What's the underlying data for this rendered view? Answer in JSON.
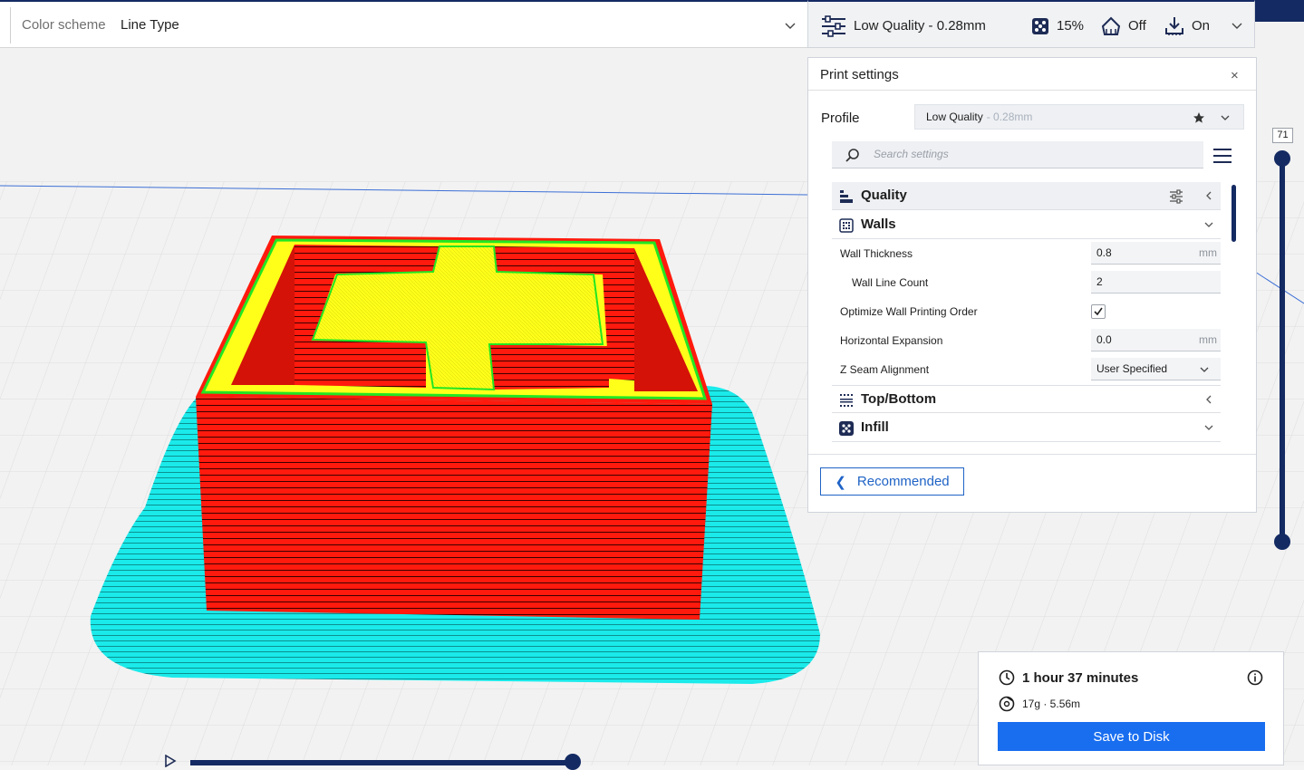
{
  "topbar": {
    "color_scheme_label": "Color scheme",
    "color_scheme_value": "Line Type",
    "quality_label": "Low Quality - 0.28mm",
    "infill_value": "15%",
    "support_value": "Off",
    "adhesion_value": "On"
  },
  "print_settings": {
    "title": "Print settings",
    "close_glyph": "×",
    "profile_label": "Profile",
    "profile_name": "Low Quality",
    "profile_detail": "- 0.28mm",
    "search_placeholder": "Search settings",
    "categories": {
      "quality": "Quality",
      "walls": "Walls",
      "top_bottom": "Top/Bottom",
      "infill": "Infill"
    },
    "settings": {
      "wall_thickness": {
        "label": "Wall Thickness",
        "value": "0.8",
        "unit": "mm"
      },
      "wall_line_count": {
        "label": "Wall Line Count",
        "value": "2"
      },
      "optimize_wall_order": {
        "label": "Optimize Wall Printing Order",
        "checked": true
      },
      "horizontal_expansion": {
        "label": "Horizontal Expansion",
        "value": "0.0",
        "unit": "mm"
      },
      "z_seam_alignment": {
        "label": "Z Seam Alignment",
        "value": "User Specified"
      }
    },
    "recommended_label": "Recommended"
  },
  "layer_slider": {
    "current_layer": "71"
  },
  "estimate": {
    "time": "1 hour 37 minutes",
    "material": "17g · 5.56m",
    "save_label": "Save to Disk"
  },
  "colors": {
    "accent_navy": "#142a63",
    "button_blue": "#196ef0",
    "wall_red": "#ff1a0d",
    "skin_yellow": "#ffff1a",
    "inner_wall_green": "#22e622",
    "skirt_cyan": "#1aeaea"
  }
}
